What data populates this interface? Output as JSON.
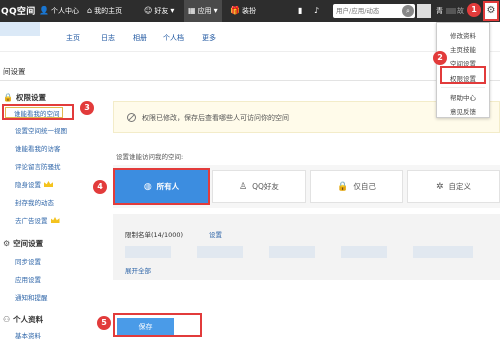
{
  "topbar": {
    "logo": "QQ空间",
    "nav": [
      {
        "icon": "person-icon",
        "glyph": "👤",
        "label": "个人中心"
      },
      {
        "icon": "home-icon",
        "glyph": "⌂",
        "label": "我的主页"
      },
      {
        "icon": "friends-icon",
        "glyph": "☺",
        "label": "好友"
      },
      {
        "icon": "apps-icon",
        "glyph": "▦",
        "label": "应用"
      },
      {
        "icon": "gift-icon",
        "glyph": "🎁",
        "label": "装扮"
      }
    ],
    "search_placeholder": "用户/应用/动态",
    "user_name_start": "青",
    "user_name_end": "故"
  },
  "page_tabs": [
    "主页",
    "日志",
    "相册",
    "个人档",
    "更多"
  ],
  "dropdown": {
    "items": [
      "修改资料",
      "主页技能",
      "空间设置",
      "权限设置",
      "帮助中心",
      "意见反馈"
    ]
  },
  "section_title": "间设置",
  "sidebar": {
    "groups": [
      {
        "heading": "权限设置",
        "icon": "lock-icon",
        "items": [
          {
            "label": "谁能看我的空间",
            "vip": false,
            "current": true
          },
          {
            "label": "设置空间统一视图",
            "vip": false,
            "current": false
          },
          {
            "label": "谁能看我的访客",
            "vip": false,
            "current": false
          },
          {
            "label": "评论留言防骚扰",
            "vip": false,
            "current": false
          },
          {
            "label": "隐身设置",
            "vip": true,
            "current": false
          },
          {
            "label": "封存我的动态",
            "vip": false,
            "current": false
          },
          {
            "label": "去广告设置",
            "vip": true,
            "current": false
          }
        ]
      },
      {
        "heading": "空间设置",
        "icon": "settings-icon",
        "items": [
          {
            "label": "同步设置"
          },
          {
            "label": "应用设置"
          },
          {
            "label": "通知和提醒"
          }
        ]
      },
      {
        "heading": "个人资料",
        "icon": "profile-icon",
        "items": [
          {
            "label": "基本资料"
          }
        ]
      }
    ]
  },
  "notice": "权限已修改，保存后查看哪些人可访问你的空间",
  "question": "设置谁能访问我的空间:",
  "options": [
    {
      "label": "所有人",
      "icon": "globe-icon",
      "glyph": "◍",
      "selected": true
    },
    {
      "label": "QQ好友",
      "icon": "friend-icon",
      "glyph": "♙",
      "selected": false
    },
    {
      "label": "仅自己",
      "icon": "lock-icon",
      "glyph": "🔒",
      "selected": false
    },
    {
      "label": "自定义",
      "icon": "custom-icon",
      "glyph": "✲",
      "selected": false
    }
  ],
  "limit": {
    "title": "限制名单(14/1000)",
    "settings_link": "设置",
    "expand": "展开全部"
  },
  "save_label": "保存",
  "annotations": [
    "1",
    "2",
    "3",
    "4",
    "5"
  ],
  "colors": {
    "topbar": "#2d2d2d",
    "selected_option": "#3c8de0",
    "callout": "#e23b3b",
    "link": "#2e65a8",
    "save_button": "#4a9be8"
  }
}
